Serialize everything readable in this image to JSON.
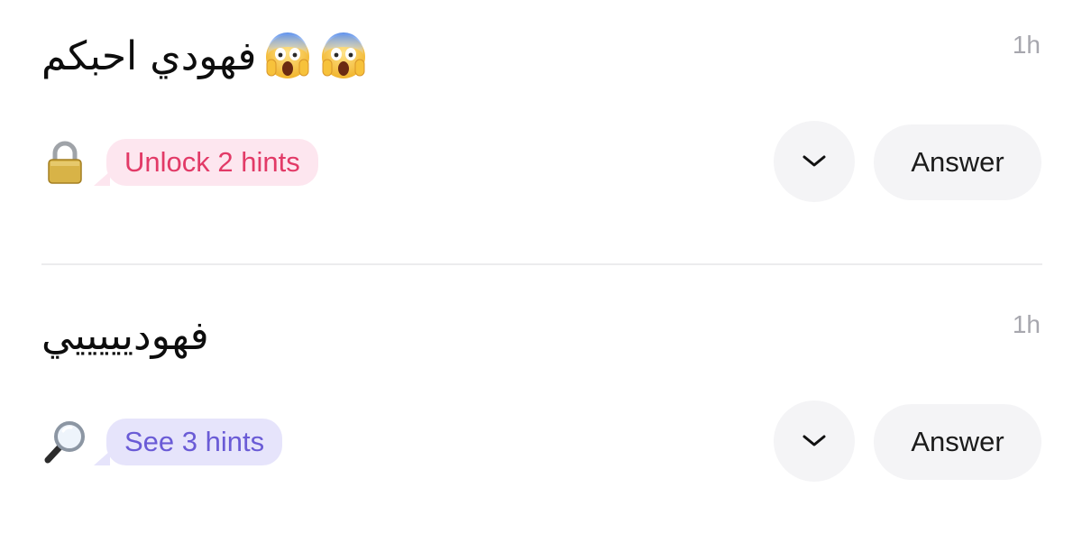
{
  "questions": [
    {
      "text": "فهودي احبكم",
      "emoji": [
        "screaming-face",
        "screaming-face"
      ],
      "time": "1h",
      "hint_icon": "padlock-icon",
      "hint_label": "Unlock 2 hints",
      "hint_color": "#e23a67",
      "answer_label": "Answer"
    },
    {
      "text": "فهوديييييي",
      "emoji": [],
      "time": "1h",
      "hint_icon": "magnifying-glass-icon",
      "hint_label": "See 3 hints",
      "hint_color": "#6a5bd6",
      "answer_label": "Answer"
    }
  ],
  "colors": {
    "timestamp": "#a7a7ae",
    "button_bg": "#f4f4f6",
    "divider": "#ececee"
  }
}
